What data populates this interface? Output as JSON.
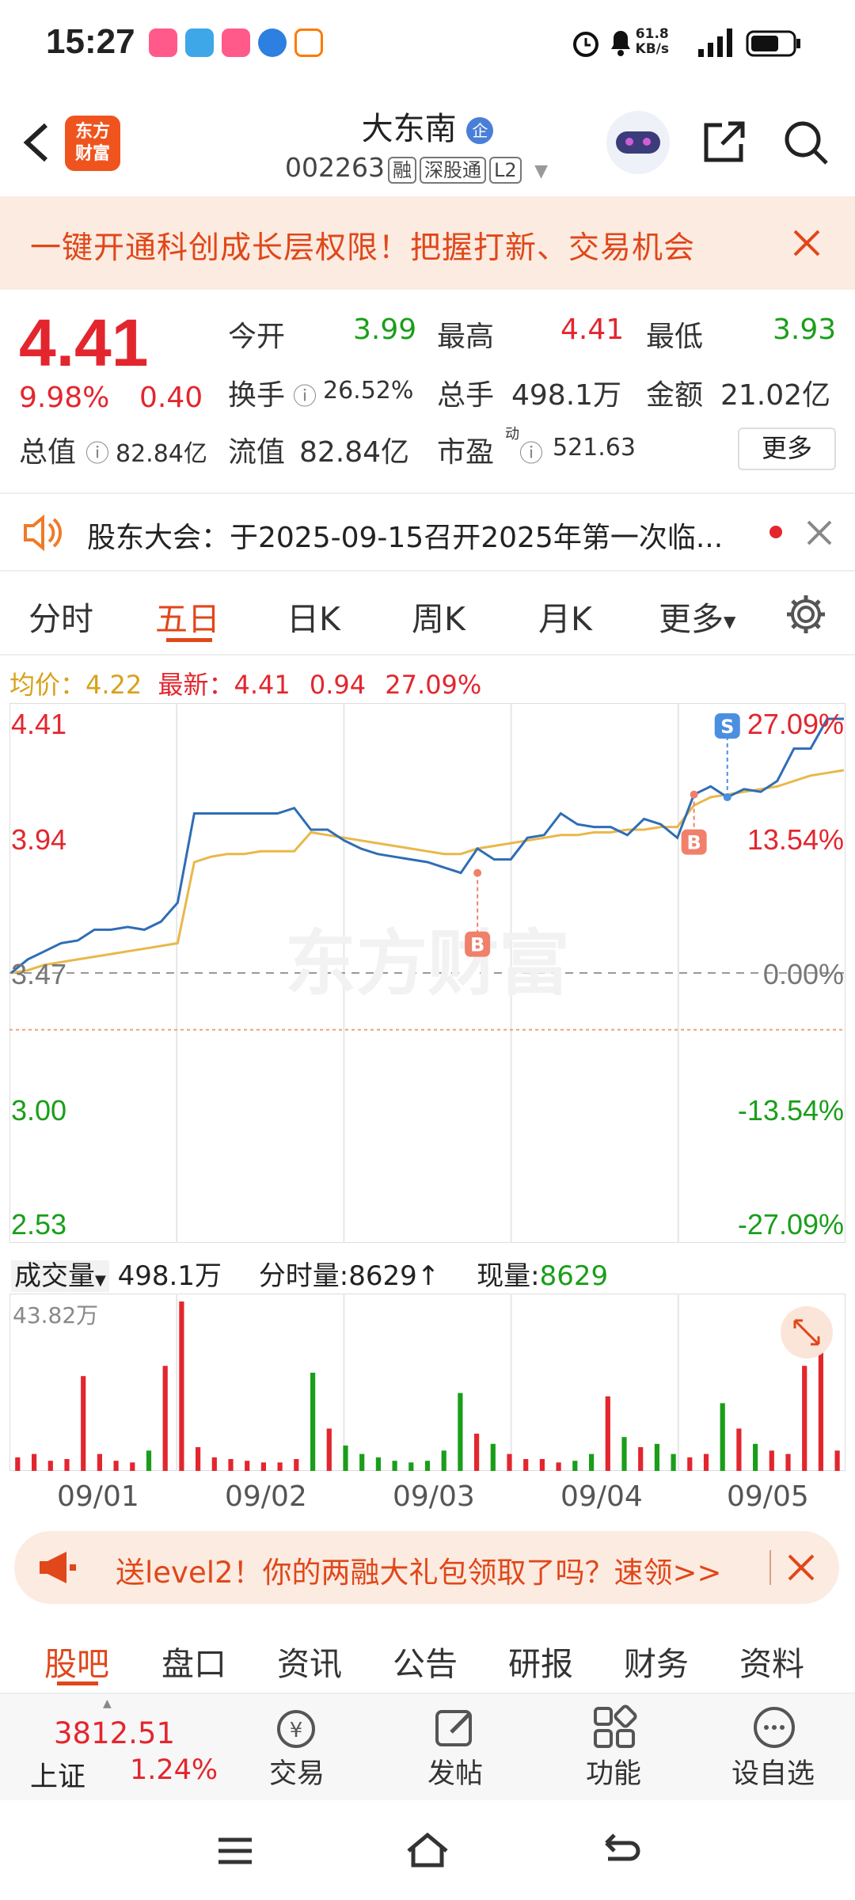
{
  "status_bar": {
    "time": "15:27",
    "net_speed_value": "61.8",
    "net_speed_unit": "KB/s"
  },
  "header": {
    "name": "大东南",
    "code": "002263",
    "tags": [
      "融",
      "深股通",
      "L2"
    ],
    "logo_line1": "东方",
    "logo_line2": "财富"
  },
  "banner": {
    "text": "一键开通科创成长层权限！把握打新、交易机会"
  },
  "quote": {
    "price": "4.41",
    "change_pct": "9.98%",
    "change": "0.40",
    "open_label": "今开",
    "open": "3.99",
    "high_label": "最高",
    "high": "4.41",
    "low_label": "最低",
    "low": "3.93",
    "turnover_label": "换手",
    "turnover": "26.52%",
    "volume_label": "总手",
    "volume": "498.1万",
    "amount_label": "金额",
    "amount": "21.02亿",
    "mktcap_label": "总值",
    "mktcap": "82.84亿",
    "float_label": "流值",
    "float": "82.84亿",
    "pe_label": "市盈",
    "pe_sup": "动",
    "pe": "521.63",
    "more_button": "更多"
  },
  "notice": {
    "text": "股东大会：于2025-09-15召开2025年第一次临..."
  },
  "tabs": [
    "分时",
    "五日",
    "日K",
    "周K",
    "月K",
    "更多"
  ],
  "active_tab": "五日",
  "chart_header": {
    "avg_label": "均价：",
    "avg": "4.22",
    "latest_label": "最新：",
    "latest": "4.41",
    "change": "0.94",
    "change_pct": "27.09%"
  },
  "chart_data": {
    "type": "line",
    "x": [
      "09/01",
      "09/02",
      "09/03",
      "09/04",
      "09/05"
    ],
    "y_ticks_left": [
      "4.41",
      "3.94",
      "3.47",
      "3.00",
      "2.53"
    ],
    "y_ticks_right": [
      "27.09%",
      "13.54%",
      "0.00%",
      "-13.54%",
      "-27.09%"
    ],
    "ylim": [
      2.53,
      4.41
    ],
    "series": [
      {
        "values": [
          3.47,
          3.52,
          3.55,
          3.58,
          3.59,
          3.63,
          3.63,
          3.64,
          3.63,
          3.66,
          3.73,
          4.06,
          4.06,
          4.06,
          4.06,
          4.06,
          4.06,
          4.08,
          4.0,
          4.0,
          3.96,
          3.93,
          3.91,
          3.9,
          3.89,
          3.88,
          3.86,
          3.84,
          3.93,
          3.89,
          3.89,
          3.97,
          3.98,
          4.06,
          4.02,
          4.01,
          4.01,
          3.98,
          4.04,
          4.02,
          3.97,
          4.13,
          4.16,
          4.12,
          4.15,
          4.14,
          4.18,
          4.3,
          4.3,
          4.41,
          4.41
        ]
      },
      {
        "values": [
          3.47,
          3.48,
          3.5,
          3.51,
          3.52,
          3.53,
          3.54,
          3.55,
          3.56,
          3.57,
          3.58,
          3.88,
          3.9,
          3.91,
          3.91,
          3.92,
          3.92,
          3.92,
          3.99,
          3.98,
          3.97,
          3.96,
          3.95,
          3.94,
          3.93,
          3.92,
          3.91,
          3.91,
          3.93,
          3.94,
          3.95,
          3.96,
          3.97,
          3.98,
          3.98,
          3.99,
          3.99,
          4.0,
          4.0,
          4.01,
          4.01,
          4.09,
          4.12,
          4.13,
          4.14,
          4.15,
          4.16,
          4.18,
          4.2,
          4.21,
          4.22
        ]
      }
    ],
    "markers": [
      {
        "label": "B",
        "x_index": 28,
        "value": 3.84
      },
      {
        "label": "B",
        "x_index": 41,
        "value": 4.13
      },
      {
        "label": "S",
        "x_index": 43,
        "value": 4.12
      }
    ],
    "colors": {
      "price": "#2f6db5",
      "avg": "#e8b84a",
      "up": "#e3262e",
      "down": "#1a9e1a"
    }
  },
  "volume": {
    "label": "成交量",
    "total": "498.1万",
    "tick_label": "分时量:",
    "tick": "8629",
    "current_label": "现量:",
    "current": "8629",
    "max_label": "43.82万"
  },
  "volume_bars": [
    0.08,
    0.1,
    0.06,
    0.07,
    0.56,
    0.1,
    0.06,
    0.05,
    0.12,
    0.62,
    1.0,
    0.14,
    0.08,
    0.07,
    0.06,
    0.05,
    0.05,
    0.07,
    0.58,
    0.25,
    0.15,
    0.1,
    0.08,
    0.06,
    0.05,
    0.06,
    0.12,
    0.46,
    0.22,
    0.16,
    0.1,
    0.07,
    0.07,
    0.05,
    0.06,
    0.1,
    0.44,
    0.2,
    0.14,
    0.16,
    0.1,
    0.08,
    0.1,
    0.4,
    0.25,
    0.16,
    0.12,
    0.1,
    0.62,
    0.9,
    0.12
  ],
  "promo": {
    "text": "送level2！你的两融大礼包领取了吗？速领>>"
  },
  "bottom_tabs": [
    "股吧",
    "盘口",
    "资讯",
    "公告",
    "研报",
    "财务",
    "资料"
  ],
  "index": {
    "value": "3812.51",
    "name": "上证",
    "change": "1.24%"
  },
  "toolbar": [
    "交易",
    "发帖",
    "功能",
    "设自选"
  ],
  "watermark": "东方财富"
}
